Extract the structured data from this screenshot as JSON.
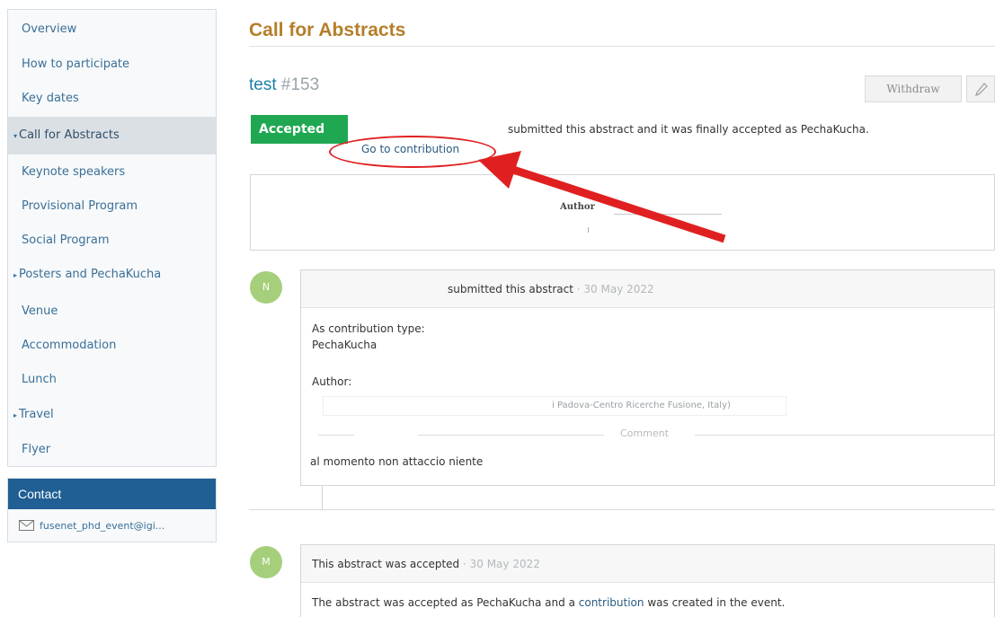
{
  "sidebar": {
    "items": [
      {
        "label": "Overview",
        "arrow": ""
      },
      {
        "label": "How to participate",
        "arrow": ""
      },
      {
        "label": "Key dates",
        "arrow": ""
      },
      {
        "label": "Call for Abstracts",
        "arrow": "▾"
      },
      {
        "label": "Keynote speakers",
        "arrow": ""
      },
      {
        "label": "Provisional Program",
        "arrow": ""
      },
      {
        "label": "Social Program",
        "arrow": ""
      },
      {
        "label": "Posters and PechaKucha",
        "arrow": "▸"
      },
      {
        "label": "Venue",
        "arrow": ""
      },
      {
        "label": "Accommodation",
        "arrow": ""
      },
      {
        "label": "Lunch",
        "arrow": ""
      },
      {
        "label": "Travel",
        "arrow": "▸"
      },
      {
        "label": "Flyer",
        "arrow": ""
      }
    ]
  },
  "contact": {
    "title": "Contact",
    "email": "fusenet_phd_event@igi..."
  },
  "main": {
    "page_title": "Call for Abstracts",
    "abstract_title": "test",
    "abstract_number": "#153",
    "withdraw_label": "Withdraw",
    "status_badge": "Accepted",
    "status_text": "submitted this abstract and it was finally accepted as PechaKucha.",
    "goto_contribution": "Go to contribution",
    "author_label": "Author"
  },
  "timeline": [
    {
      "avatar": "N",
      "head_text": "submitted this abstract",
      "date": "· 30 May 2022",
      "contribution_type_label": "As contribution type:",
      "contribution_type": "PechaKucha",
      "author_label": "Author:",
      "author_affiliation": "i Padova-Centro Ricerche Fusione, Italy)",
      "comment_label": "Comment",
      "comment_text": "al momento non attaccio niente"
    },
    {
      "avatar": "M",
      "head_text": "This abstract was accepted",
      "date": "· 30 May 2022",
      "body_prefix": "The abstract was accepted as PechaKucha and a",
      "body_link": "contribution",
      "body_suffix": "was created in the event."
    }
  ],
  "colors": {
    "accent_gold": "#b57e2a",
    "link_blue": "#1e7fa9",
    "contact_blue": "#1f5f93",
    "accepted_green": "#1fa851",
    "annotation_red": "#e02020"
  }
}
